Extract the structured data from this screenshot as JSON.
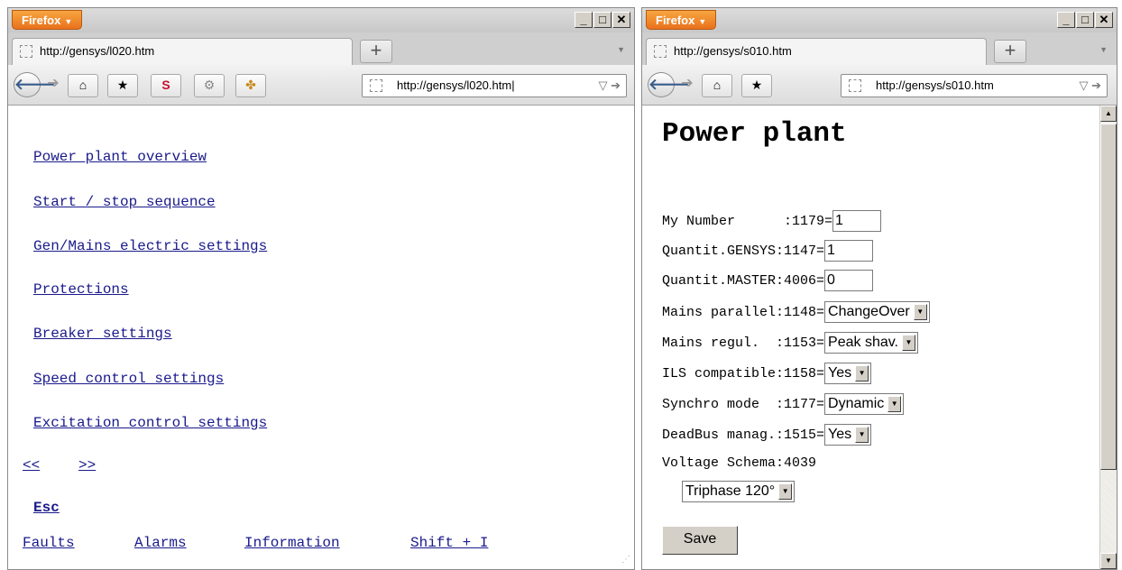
{
  "window_left": {
    "menu_button": "Firefox",
    "tab_title": "http://gensys/l020.htm",
    "url": "http://gensys/l020.htm",
    "links": [
      "Power plant overview",
      "Start / stop sequence",
      "Gen/Mains electric settings",
      "Protections",
      "Breaker settings",
      "Speed control settings",
      "Excitation control settings"
    ],
    "prev": "<<",
    "next": ">>",
    "esc": "Esc",
    "bottom_links": [
      "Faults",
      "Alarms",
      "Information",
      "Shift + I"
    ]
  },
  "window_right": {
    "menu_button": "Firefox",
    "tab_title": "http://gensys/s010.htm",
    "url": "http://gensys/s010.htm",
    "page_title": "Power plant",
    "fields": [
      {
        "label": "My Number      :1179=",
        "value": "1"
      },
      {
        "label": "Quantit.GENSYS:1147=",
        "value": "1"
      },
      {
        "label": "Quantit.MASTER:4006=",
        "value": "0"
      }
    ],
    "selects": [
      {
        "label": "Mains parallel:1148=",
        "value": "ChangeOver"
      },
      {
        "label": "Mains regul.  :1153=",
        "value": "Peak shav."
      },
      {
        "label": "ILS compatible:1158=",
        "value": "Yes"
      },
      {
        "label": "Synchro mode  :1177=",
        "value": "Dynamic"
      },
      {
        "label": "DeadBus manag.:1515=",
        "value": "Yes"
      }
    ],
    "voltage_label": "Voltage Schema:4039",
    "voltage_value": "Triphase 120°",
    "save_label": "Save"
  },
  "window_controls": {
    "minimize": "_",
    "maximize": "□",
    "close": "✕"
  },
  "icons": [
    "back-arrow-icon",
    "forward-arrow-icon",
    "home-icon",
    "bookmark-icon",
    "s-addon-icon",
    "gear-addon-icon",
    "puzzle-addon-icon",
    "go-arrow-icon"
  ],
  "colors": {
    "link": "#1a1a8c",
    "firefox_button": "#e9711c"
  }
}
